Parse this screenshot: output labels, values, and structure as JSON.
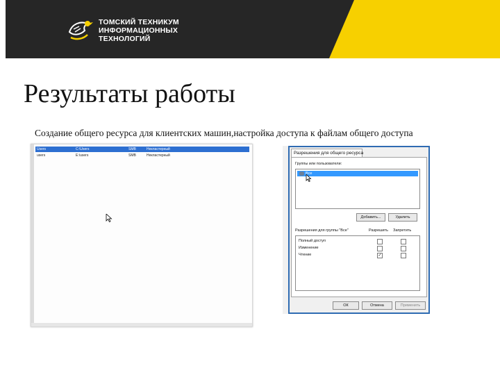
{
  "header": {
    "org_line1": "ТОМСКИЙ ТЕХНИКУМ",
    "org_line2": "ИНФОРМАЦИОННЫХ",
    "org_line3": "ТЕХНОЛОГИЙ",
    "colors": {
      "dark": "#262626",
      "accent": "#f7d000"
    }
  },
  "slide": {
    "title": "Результаты работы",
    "subtitle": "Создание общего ресурса для клиентских машин,настройка доступа к файлам общего доступа"
  },
  "share_list": {
    "rows": [
      {
        "name": "Users",
        "path": "C:\\Users",
        "protocol": "SMB",
        "type": "Некластерный",
        "selected": true
      },
      {
        "name": "users",
        "path": "E:\\users",
        "protocol": "SMB",
        "type": "Некластерный",
        "selected": false
      }
    ]
  },
  "share_dialog": {
    "tab": "Разрешения для общего ресурса",
    "groups_label": "Группы или пользователи:",
    "groups": [
      "Все"
    ],
    "add_button": "Добавить...",
    "remove_button": "Удалить",
    "perm_header": "Разрешения для группы \"Все\"",
    "allow_header": "Разрешить",
    "deny_header": "Запретить",
    "permissions": [
      {
        "name": "Полный доступ",
        "allow": false,
        "deny": false
      },
      {
        "name": "Изменение",
        "allow": false,
        "deny": false
      },
      {
        "name": "Чтение",
        "allow": true,
        "deny": false
      }
    ],
    "ok_button": "ОК",
    "cancel_button": "Отмена",
    "apply_button": "Применить"
  }
}
